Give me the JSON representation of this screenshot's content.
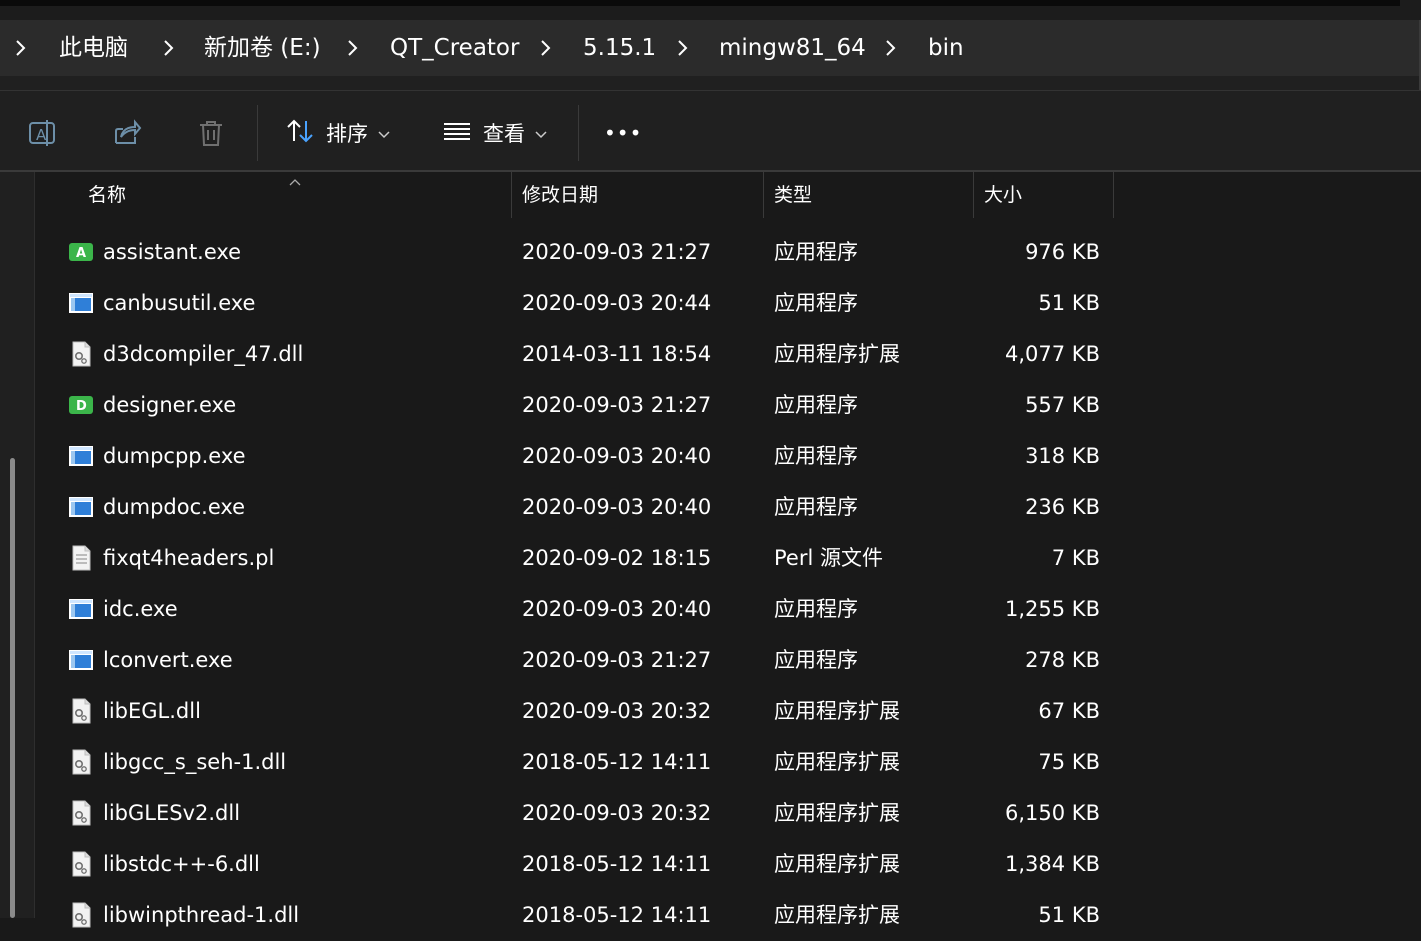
{
  "breadcrumb": {
    "items": [
      "此电脑",
      "新加卷 (E:)",
      "QT_Creator",
      "5.15.1",
      "mingw81_64",
      "bin"
    ]
  },
  "toolbar": {
    "sort_label": "排序",
    "view_label": "查看",
    "more_label": "•••"
  },
  "columns": {
    "name": "名称",
    "modified": "修改日期",
    "type": "类型",
    "size": "大小"
  },
  "files": [
    {
      "name": "assistant.exe",
      "modified": "2020-09-03 21:27",
      "type": "应用程序",
      "size": "976 KB",
      "icon": "assistant-app-icon"
    },
    {
      "name": "canbusutil.exe",
      "modified": "2020-09-03 20:44",
      "type": "应用程序",
      "size": "51 KB",
      "icon": "exe-window-icon"
    },
    {
      "name": "d3dcompiler_47.dll",
      "modified": "2014-03-11 18:54",
      "type": "应用程序扩展",
      "size": "4,077 KB",
      "icon": "dll-gear-icon"
    },
    {
      "name": "designer.exe",
      "modified": "2020-09-03 21:27",
      "type": "应用程序",
      "size": "557 KB",
      "icon": "designer-app-icon"
    },
    {
      "name": "dumpcpp.exe",
      "modified": "2020-09-03 20:40",
      "type": "应用程序",
      "size": "318 KB",
      "icon": "exe-window-icon"
    },
    {
      "name": "dumpdoc.exe",
      "modified": "2020-09-03 20:40",
      "type": "应用程序",
      "size": "236 KB",
      "icon": "exe-window-icon"
    },
    {
      "name": "fixqt4headers.pl",
      "modified": "2020-09-02 18:15",
      "type": "Perl 源文件",
      "size": "7 KB",
      "icon": "text-file-icon"
    },
    {
      "name": "idc.exe",
      "modified": "2020-09-03 20:40",
      "type": "应用程序",
      "size": "1,255 KB",
      "icon": "exe-window-icon"
    },
    {
      "name": "lconvert.exe",
      "modified": "2020-09-03 21:27",
      "type": "应用程序",
      "size": "278 KB",
      "icon": "exe-window-icon"
    },
    {
      "name": "libEGL.dll",
      "modified": "2020-09-03 20:32",
      "type": "应用程序扩展",
      "size": "67 KB",
      "icon": "dll-gear-icon"
    },
    {
      "name": "libgcc_s_seh-1.dll",
      "modified": "2018-05-12 14:11",
      "type": "应用程序扩展",
      "size": "75 KB",
      "icon": "dll-gear-icon"
    },
    {
      "name": "libGLESv2.dll",
      "modified": "2020-09-03 20:32",
      "type": "应用程序扩展",
      "size": "6,150 KB",
      "icon": "dll-gear-icon"
    },
    {
      "name": "libstdc++-6.dll",
      "modified": "2018-05-12 14:11",
      "type": "应用程序扩展",
      "size": "1,384 KB",
      "icon": "dll-gear-icon"
    },
    {
      "name": "libwinpthread-1.dll",
      "modified": "2018-05-12 14:11",
      "type": "应用程序扩展",
      "size": "51 KB",
      "icon": "dll-gear-icon"
    }
  ],
  "colors": {
    "background": "#191919",
    "breadcrumb_bg": "#2b2b2b",
    "toolbar_bg": "#202020",
    "exe_blue": "#2f7fd8",
    "app_green": "#3bb54a"
  }
}
